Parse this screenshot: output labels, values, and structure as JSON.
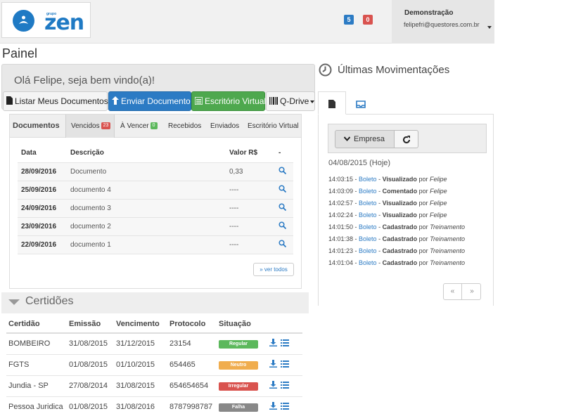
{
  "header": {
    "logo_small": "grupo",
    "logo_text": "zen",
    "badge_blue": "5",
    "badge_red": "0",
    "user_name": "Demonstração",
    "user_email": "felipefri@questores.com.br"
  },
  "page_title": "Painel",
  "welcome": {
    "text": "Olá Felipe, seja bem vindo(a)!",
    "buttons": {
      "listar": "Listar Meus Documentos",
      "enviar": "Enviar Documento",
      "escritorio": "Escritório Virtual",
      "qdrive": "Q-Drive"
    }
  },
  "documents": {
    "title": "Documentos",
    "tabs": {
      "vencidos": "Vencidos",
      "vencidos_badge": "23",
      "a_vencer": "À Vencer",
      "a_vencer_badge": "0",
      "recebidos": "Recebidos",
      "enviados": "Enviados",
      "escritorio": "Escritório Virtual"
    },
    "columns": {
      "data": "Data",
      "descricao": "Descrição",
      "valor": "Valor R$",
      "acao": "-"
    },
    "rows": [
      {
        "data": "28/09/2016",
        "descricao": "Documento",
        "valor": "0,33"
      },
      {
        "data": "25/09/2016",
        "descricao": "documento 4",
        "valor": "----"
      },
      {
        "data": "24/09/2016",
        "descricao": "documento 3",
        "valor": "----"
      },
      {
        "data": "23/09/2016",
        "descricao": "documento 2",
        "valor": "----"
      },
      {
        "data": "22/09/2016",
        "descricao": "documento 1",
        "valor": "----"
      }
    ],
    "ver_todos": "» ver todos"
  },
  "certidoes": {
    "title": "Certidões",
    "columns": {
      "certidao": "Certidão",
      "emissao": "Emissão",
      "vencimento": "Vencimento",
      "protocolo": "Protocolo",
      "situacao": "Situação"
    },
    "rows": [
      {
        "certidao": "BOMBEIRO",
        "emissao": "31/08/2015",
        "vencimento": "31/12/2015",
        "protocolo": "23154",
        "situacao": "Regular",
        "color": "#5cb85c"
      },
      {
        "certidao": "FGTS",
        "emissao": "01/08/2015",
        "vencimento": "01/10/2015",
        "protocolo": "654465",
        "situacao": "Neutro",
        "color": "#f0ad4e"
      },
      {
        "certidao": "Jundia - SP",
        "emissao": "27/08/2014",
        "vencimento": "31/08/2015",
        "protocolo": "654654654",
        "situacao": "Irregular",
        "color": "#d9534f"
      },
      {
        "certidao": "Pessoa Juridica",
        "emissao": "01/08/2015",
        "vencimento": "31/08/2016",
        "protocolo": "8787998787",
        "situacao": "Falha",
        "color": "#888888"
      }
    ]
  },
  "movimentacoes": {
    "title": "Últimas Movimentações",
    "filter_label": "Empresa",
    "date_label": "04/08/2015 (Hoje)",
    "by": "por",
    "items": [
      {
        "time": "14:03:15",
        "doc": "Boleto",
        "action": "Visualizado",
        "user": "Felipe"
      },
      {
        "time": "14:03:09",
        "doc": "Boleto",
        "action": "Comentado",
        "user": "Felipe"
      },
      {
        "time": "14:02:57",
        "doc": "Boleto",
        "action": "Visualizado",
        "user": "Felipe"
      },
      {
        "time": "14:02:24",
        "doc": "Boleto",
        "action": "Visualizado",
        "user": "Felipe"
      },
      {
        "time": "14:01:50",
        "doc": "Boleto",
        "action": "Cadastrado",
        "user": "Treinamento"
      },
      {
        "time": "14:01:38",
        "doc": "Boleto",
        "action": "Cadastrado",
        "user": "Treinamento"
      },
      {
        "time": "14:01:23",
        "doc": "Boleto",
        "action": "Cadastrado",
        "user": "Treinamento"
      },
      {
        "time": "14:01:04",
        "doc": "Boleto",
        "action": "Cadastrado",
        "user": "Treinamento"
      }
    ],
    "pager_prev": "«",
    "pager_next": "»"
  }
}
